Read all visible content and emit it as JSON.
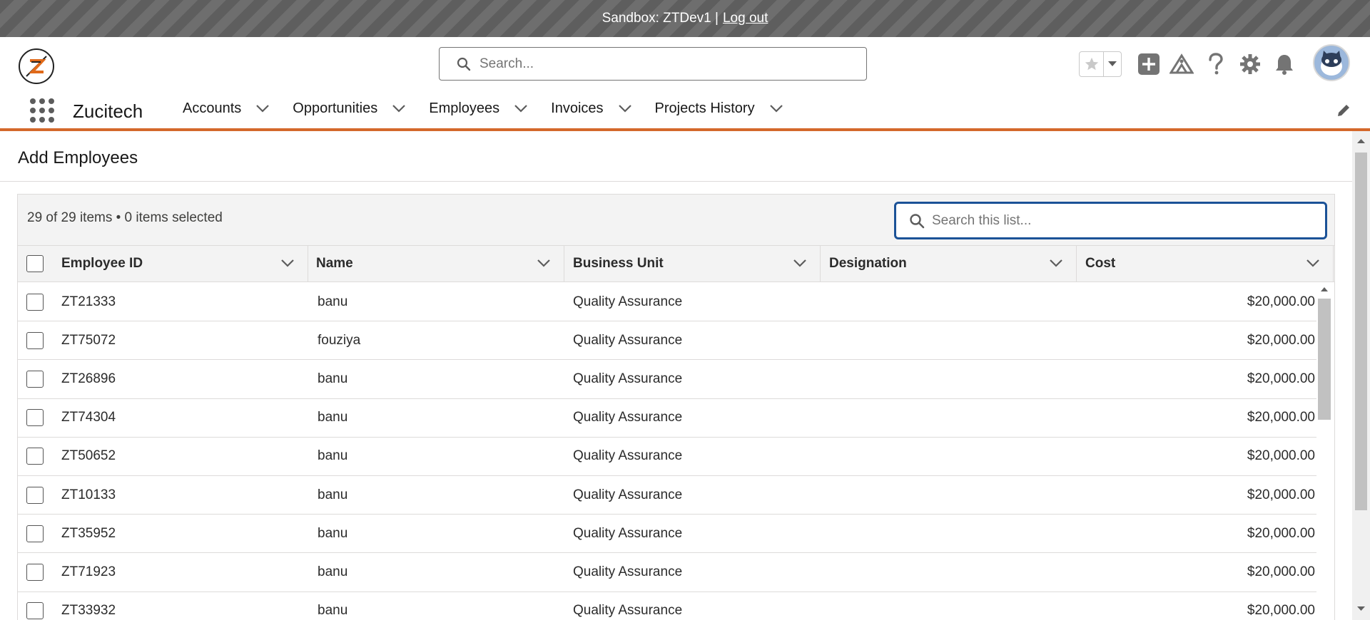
{
  "sandbox": {
    "label": "Sandbox: ZTDev1 |",
    "logout": "Log out"
  },
  "header": {
    "search_placeholder": "Search...",
    "icons": [
      "favorites-star-icon",
      "add-icon",
      "trailhead-icon",
      "help-icon",
      "setup-gear-icon",
      "notifications-bell-icon",
      "user-avatar"
    ]
  },
  "nav": {
    "app_name": "Zucitech",
    "items": [
      {
        "label": "Accounts"
      },
      {
        "label": "Opportunities"
      },
      {
        "label": "Employees"
      },
      {
        "label": "Invoices"
      },
      {
        "label": "Projects History"
      }
    ]
  },
  "card": {
    "title": "Add Employees",
    "item_count": "29 of 29 items • 0 items selected",
    "list_search_placeholder": "Search this list..."
  },
  "table": {
    "columns": [
      "Employee ID",
      "Name",
      "Business Unit",
      "Designation",
      "Cost"
    ],
    "rows": [
      {
        "id": "ZT21333",
        "name": "banu",
        "unit": "Quality Assurance",
        "designation": "",
        "cost": "$20,000.00"
      },
      {
        "id": "ZT75072",
        "name": "fouziya",
        "unit": "Quality Assurance",
        "designation": "",
        "cost": "$20,000.00"
      },
      {
        "id": "ZT26896",
        "name": "banu",
        "unit": "Quality Assurance",
        "designation": "",
        "cost": "$20,000.00"
      },
      {
        "id": "ZT74304",
        "name": "banu",
        "unit": "Quality Assurance",
        "designation": "",
        "cost": "$20,000.00"
      },
      {
        "id": "ZT50652",
        "name": "banu",
        "unit": "Quality Assurance",
        "designation": "",
        "cost": "$20,000.00"
      },
      {
        "id": "ZT10133",
        "name": "banu",
        "unit": "Quality Assurance",
        "designation": "",
        "cost": "$20,000.00"
      },
      {
        "id": "ZT35952",
        "name": "banu",
        "unit": "Quality Assurance",
        "designation": "",
        "cost": "$20,000.00"
      },
      {
        "id": "ZT71923",
        "name": "banu",
        "unit": "Quality Assurance",
        "designation": "",
        "cost": "$20,000.00"
      },
      {
        "id": "ZT33932",
        "name": "banu",
        "unit": "Quality Assurance",
        "designation": "",
        "cost": "$20,000.00"
      }
    ]
  },
  "colors": {
    "accent": "#d4682b",
    "focus_border": "#1b5297",
    "header_gray": "#f3f3f3"
  }
}
